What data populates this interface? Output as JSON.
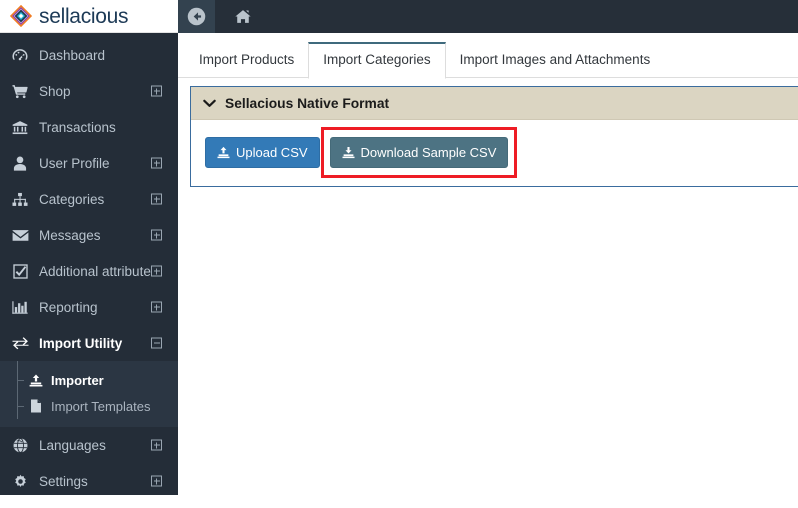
{
  "brand": {
    "name": "sellacious",
    "logo_icon": "sellacious-diamond-logo"
  },
  "topbar": {
    "back_icon": "arrow-circle-left-icon",
    "home_icon": "home-icon"
  },
  "sidebar": {
    "items": [
      {
        "label": "Dashboard",
        "icon": "dashboard-gauge-icon",
        "expandable": false,
        "state": ""
      },
      {
        "label": "Shop",
        "icon": "shopping-cart-icon",
        "expandable": true,
        "state": "collapsed"
      },
      {
        "label": "Transactions",
        "icon": "bank-icon",
        "expandable": false,
        "state": ""
      },
      {
        "label": "User Profile",
        "icon": "user-icon",
        "expandable": true,
        "state": "collapsed"
      },
      {
        "label": "Categories",
        "icon": "sitemap-icon",
        "expandable": true,
        "state": "collapsed"
      },
      {
        "label": "Messages",
        "icon": "envelope-icon",
        "expandable": true,
        "state": "collapsed"
      },
      {
        "label": "Additional attribute",
        "icon": "checkbox-check-icon",
        "expandable": true,
        "state": "collapsed"
      },
      {
        "label": "Reporting",
        "icon": "bar-chart-icon",
        "expandable": true,
        "state": "collapsed"
      },
      {
        "label": "Import Utility",
        "icon": "exchange-arrows-icon",
        "expandable": true,
        "state": "expanded"
      },
      {
        "label": "Languages",
        "icon": "globe-icon",
        "expandable": true,
        "state": "collapsed"
      },
      {
        "label": "Settings",
        "icon": "gear-icon",
        "expandable": true,
        "state": "collapsed"
      }
    ],
    "submenu": {
      "parent": "Import Utility",
      "items": [
        {
          "label": "Importer",
          "icon": "upload-icon",
          "active": true
        },
        {
          "label": "Import Templates",
          "icon": "file-blank-icon",
          "active": false
        }
      ]
    }
  },
  "tabs": [
    {
      "label": "Import Products",
      "active": false
    },
    {
      "label": "Import Categories",
      "active": true
    },
    {
      "label": "Import Images and Attachments",
      "active": false
    }
  ],
  "panel": {
    "title": "Sellacious Native Format",
    "collapse_icon": "chevron-down-icon",
    "buttons": [
      {
        "label": "Upload CSV",
        "icon": "upload-icon",
        "style": "primary",
        "highlighted": false
      },
      {
        "label": "Download Sample CSV",
        "icon": "download-icon",
        "style": "slate",
        "highlighted": true
      }
    ]
  },
  "colors": {
    "sidebar_bg": "#242d38",
    "submenu_bg": "#2b3643",
    "topbar_bg": "#262f39",
    "panel_header_bg": "#dbd5c2",
    "panel_border": "#3a6c9e",
    "primary_button": "#337ab7",
    "slate_button": "#4d7383",
    "highlight_red": "#ee1c25",
    "active_tab_border": "#3f6a7d",
    "brand_text": "#1d3a56"
  }
}
